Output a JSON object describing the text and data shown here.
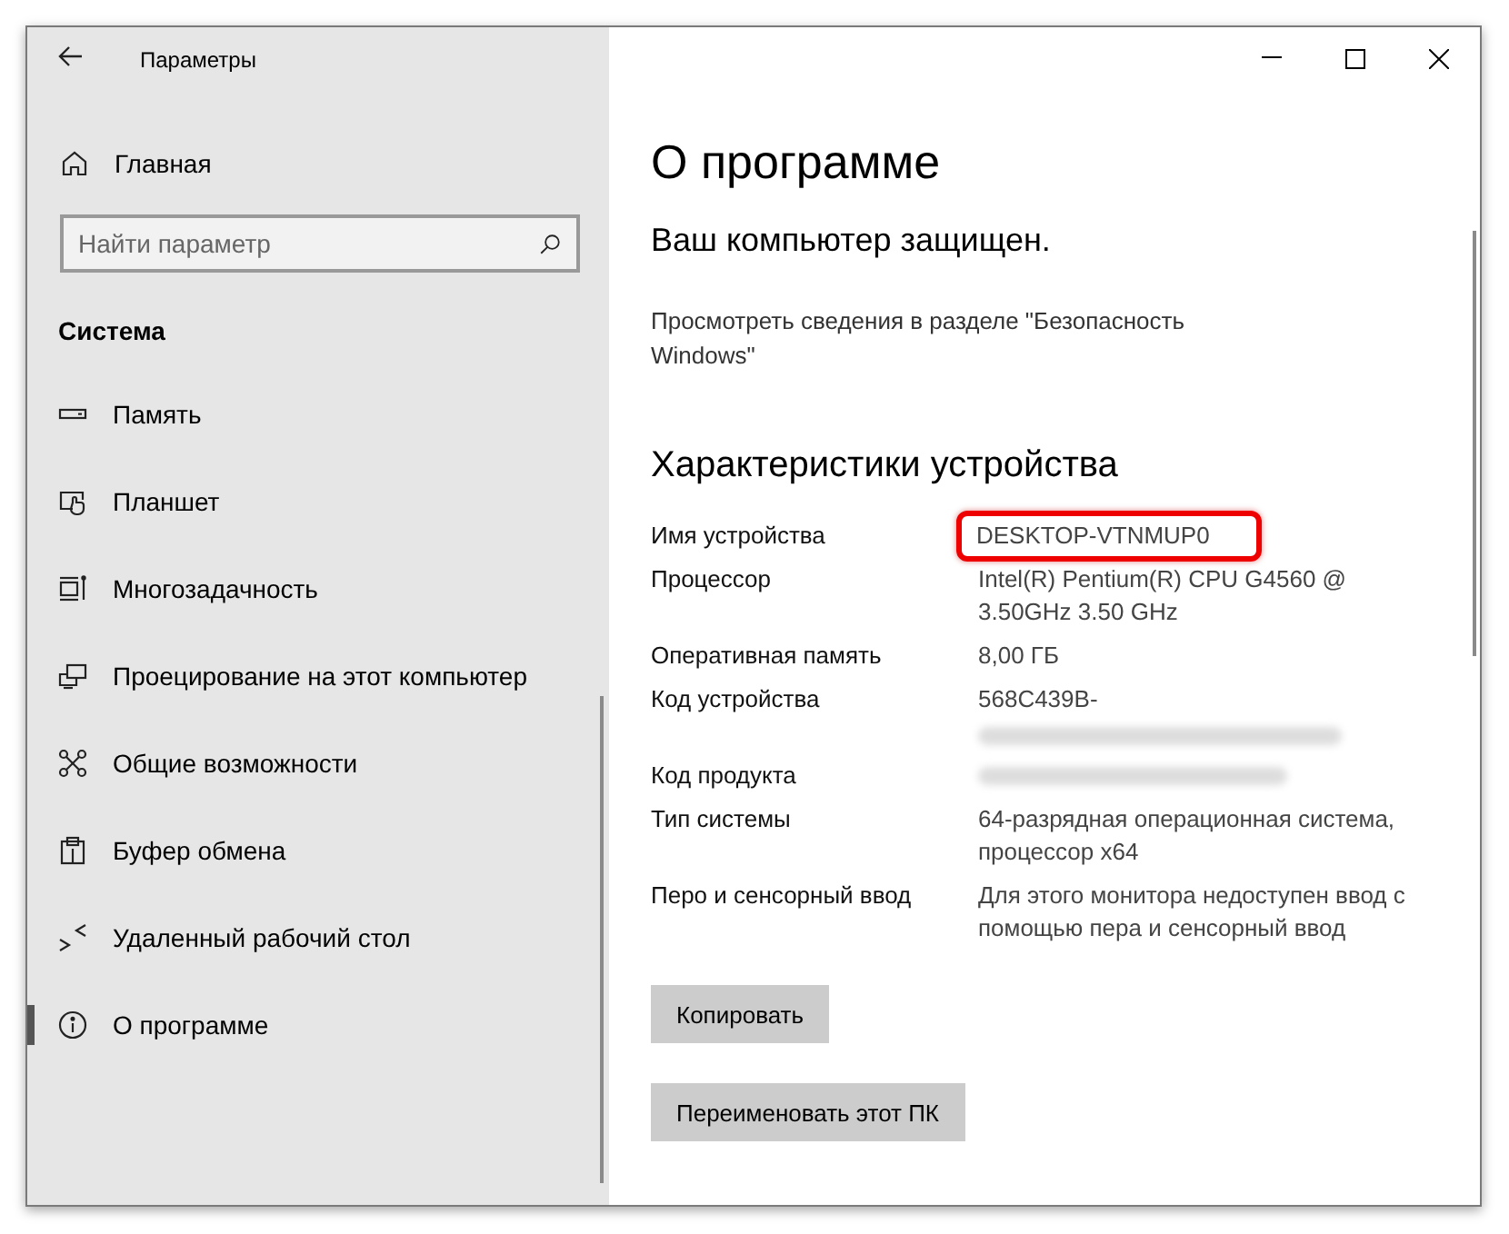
{
  "window": {
    "title": "Параметры"
  },
  "sidebar": {
    "home": "Главная",
    "search": {
      "placeholder": "Найти параметр"
    },
    "section": "Система",
    "items": [
      {
        "label": "Память",
        "selected": false
      },
      {
        "label": "Планшет",
        "selected": false
      },
      {
        "label": "Многозадачность",
        "selected": false
      },
      {
        "label": "Проецирование на этот компьютер",
        "selected": false
      },
      {
        "label": "Общие возможности",
        "selected": false
      },
      {
        "label": "Буфер обмена",
        "selected": false
      },
      {
        "label": "Удаленный рабочий стол",
        "selected": false
      },
      {
        "label": "О программе",
        "selected": true
      }
    ]
  },
  "main": {
    "title": "О программе",
    "protection": {
      "heading": "Ваш компьютер защищен.",
      "text": "Просмотреть сведения в разделе \"Безопасность Windows\""
    },
    "specs": {
      "heading": "Характеристики устройства",
      "rows": [
        {
          "label": "Имя устройства",
          "value": "DESKTOP-VTNMUP0",
          "highlighted": true,
          "blurred": false
        },
        {
          "label": "Процессор",
          "value": "Intel(R) Pentium(R) CPU G4560 @ 3.50GHz   3.50 GHz",
          "highlighted": false,
          "blurred": false
        },
        {
          "label": "Оперативная память",
          "value": "8,00 ГБ",
          "highlighted": false,
          "blurred": false
        },
        {
          "label": "Код устройства",
          "value": "568C439B-",
          "highlighted": false,
          "blurred": true
        },
        {
          "label": "Код продукта",
          "highlighted": false,
          "blurred": true
        },
        {
          "label": "Тип системы",
          "value": "64-разрядная операционная система, процессор x64",
          "highlighted": false,
          "blurred": false
        },
        {
          "label": "Перо и сенсорный ввод",
          "value": "Для этого монитора недоступен ввод с помощью пера и сенсорный ввод",
          "highlighted": false,
          "blurred": false
        }
      ]
    },
    "buttons": [
      "Копировать",
      "Переименовать этот ПК"
    ]
  }
}
